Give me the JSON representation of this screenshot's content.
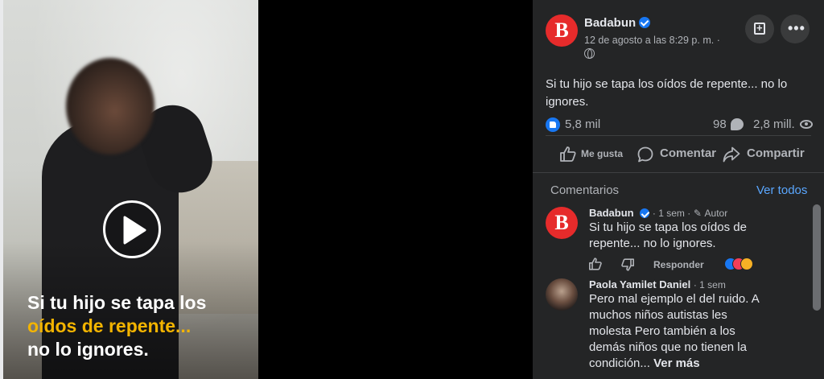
{
  "video": {
    "caption_line1": "Si tu hijo se tapa los",
    "caption_line2": "oídos de repente...",
    "caption_line3": "no lo ignores.",
    "caption_accent_color": "#f3b400",
    "play_icon": "play-icon"
  },
  "post": {
    "logo_letter": "B",
    "brand_color": "#e62b2b",
    "author": "Badabun",
    "date": "12 de agosto a las 8:29 p. m. ·",
    "text": "Si tu hijo se tapa los oídos de repente... no lo ignores.",
    "likes": "5,8 mil",
    "comments": "98",
    "views": "2,8 mill."
  },
  "actions": {
    "like": "Me gusta",
    "comment": "Comentar",
    "share": "Compartir"
  },
  "comments_section": {
    "title": "Comentarios",
    "see_all": "Ver todos",
    "items": [
      {
        "author": "Badabun",
        "time": "· 1 sem ·",
        "badge": "Autor",
        "text": "Si tu hijo se tapa los oídos de repente... no lo ignores.",
        "reply": "Responder"
      },
      {
        "author": "Paola Yamilet Daniel",
        "time": "· 1 sem",
        "text": "Pero mal ejemplo el del ruido. A muchos niños autistas les molesta Pero también a los demás niños que no tienen la condición...",
        "see_more": "Ver más"
      }
    ]
  },
  "link_color": "#5aa7ff"
}
